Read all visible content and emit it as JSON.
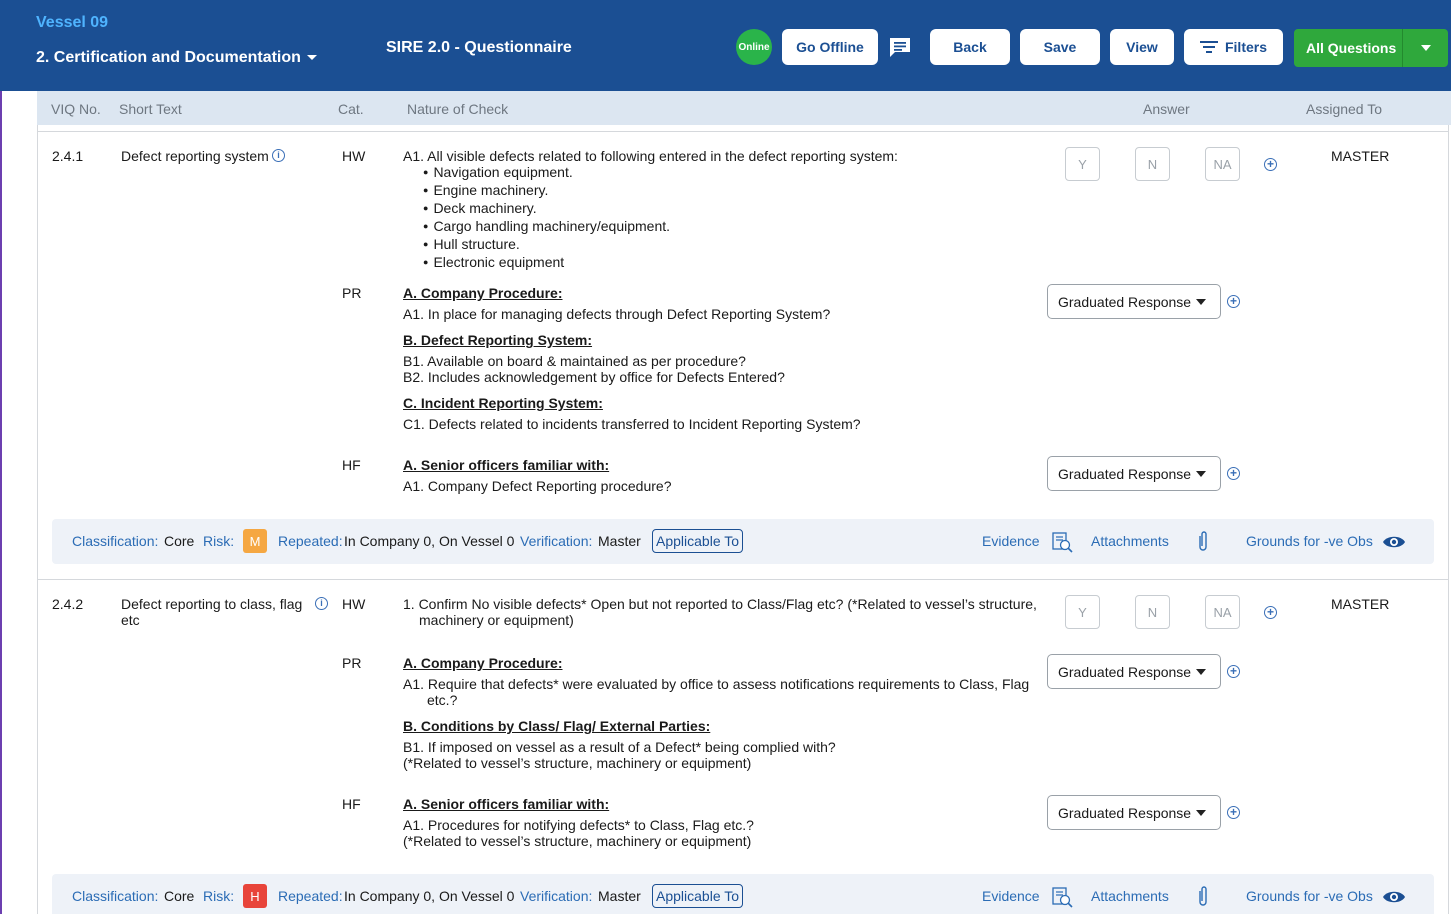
{
  "header": {
    "vessel": "Vessel 09",
    "section": "2. Certification and Documentation",
    "title": "SIRE 2.0 - Questionnaire",
    "online_label": "Online",
    "go_offline": "Go Offline",
    "back": "Back",
    "save": "Save",
    "view": "View",
    "filters": "Filters",
    "all_questions": "All Questions"
  },
  "columns": {
    "viq": "VIQ No.",
    "short": "Short Text",
    "cat": "Cat.",
    "nature": "Nature of Check",
    "answer": "Answer",
    "assigned": "Assigned To"
  },
  "answer_options": {
    "y": "Y",
    "n": "N",
    "na": "NA"
  },
  "dropdown_label": "Graduated Response",
  "questions": [
    {
      "viq": "2.4.1",
      "short": "Defect reporting system",
      "assigned": "MASTER",
      "hw_cat": "HW",
      "hw_text": "A1. All visible defects related to following entered in the defect reporting system:",
      "hw_bullets": [
        "Navigation equipment.",
        "Engine machinery.",
        "Deck machinery.",
        "Cargo handling machinery/equipment.",
        "Hull structure.",
        "Electronic equipment"
      ],
      "pr_cat": "PR",
      "pr_a_head": "A. Company Procedure:",
      "pr_a1": "A1. In place for managing defects through Defect Reporting System?",
      "pr_b_head": "B. Defect Reporting System:",
      "pr_b1": "B1. Available on board & maintained as per procedure?",
      "pr_b2": "B2. Includes acknowledgement by office for Defects Entered?",
      "pr_c_head": "C. Incident Reporting System:",
      "pr_c1": "C1. Defects related to incidents transferred to Incident Reporting System?",
      "hf_cat": "HF",
      "hf_head": "A. Senior officers familiar with:",
      "hf_a1": "A1. Company Defect Reporting procedure?",
      "footer": {
        "classification_label": "Classification:",
        "classification": "Core",
        "risk_label": "Risk:",
        "risk": "M",
        "risk_color": "#f5a742",
        "repeated_label": "Repeated:",
        "repeated": "In Company 0, On Vessel 0",
        "verification_label": "Verification:",
        "verification": "Master",
        "applicable": "Applicable To",
        "evidence": "Evidence",
        "attachments": "Attachments",
        "grounds": "Grounds for -ve Obs"
      }
    },
    {
      "viq": "2.4.2",
      "short_line1": "Defect reporting to class, flag",
      "short_line2": "etc",
      "assigned": "MASTER",
      "hw_cat": "HW",
      "hw_line1": "1. Confirm No visible defects* Open but not reported to Class/Flag etc? (*Related to vessel’s structure,",
      "hw_line2": "machinery or equipment)",
      "pr_cat": "PR",
      "pr_a_head": "A. Company Procedure:",
      "pr_a1_line1": "A1. Require that defects* were evaluated by office to assess notifications requirements to Class, Flag",
      "pr_a1_line2": "etc.?",
      "pr_b_head": "B. Conditions by Class/ Flag/ External Parties:",
      "pr_b1_line1": "B1. If imposed on vessel as a result of a Defect* being complied with?",
      "pr_b1_line2": "(*Related to vessel’s structure, machinery or equipment)",
      "hf_cat": "HF",
      "hf_head": "A. Senior officers familiar with:",
      "hf_a1_line1": "A1. Procedures for notifying defects* to Class, Flag etc.?",
      "hf_a1_line2": "(*Related to vessel’s structure, machinery or equipment)",
      "footer": {
        "classification_label": "Classification:",
        "classification": "Core",
        "risk_label": "Risk:",
        "risk": "H",
        "risk_color": "#e8443a",
        "repeated_label": "Repeated:",
        "repeated": "In Company 0, On Vessel 0",
        "verification_label": "Verification:",
        "verification": "Master",
        "applicable": "Applicable To",
        "evidence": "Evidence",
        "attachments": "Attachments",
        "grounds": "Grounds for -ve Obs"
      }
    }
  ]
}
